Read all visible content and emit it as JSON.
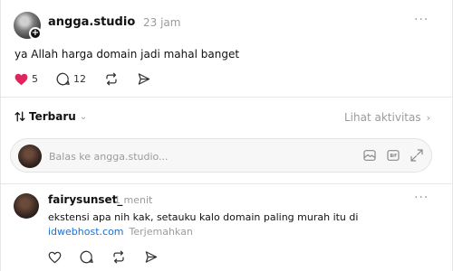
{
  "post": {
    "username": "angga.studio",
    "time": "23 jam",
    "text": "ya Allah harga domain jadi mahal banget",
    "likes": "5",
    "replies": "12"
  },
  "sort": {
    "label": "Terbaru",
    "activity": "Lihat aktivitas"
  },
  "reply_box": {
    "placeholder": "Balas ke angga.studio..."
  },
  "comment": {
    "username": "fairysunset_",
    "time": "1 menit",
    "text": "ekstensi apa nih kak, setauku kalo domain paling murah itu di",
    "link": "idwebhost.com",
    "translate": "Terjemahkan"
  },
  "colors": {
    "like_red": "#e0245e",
    "link_blue": "#1d6fd1",
    "muted": "#9b9b9b"
  }
}
